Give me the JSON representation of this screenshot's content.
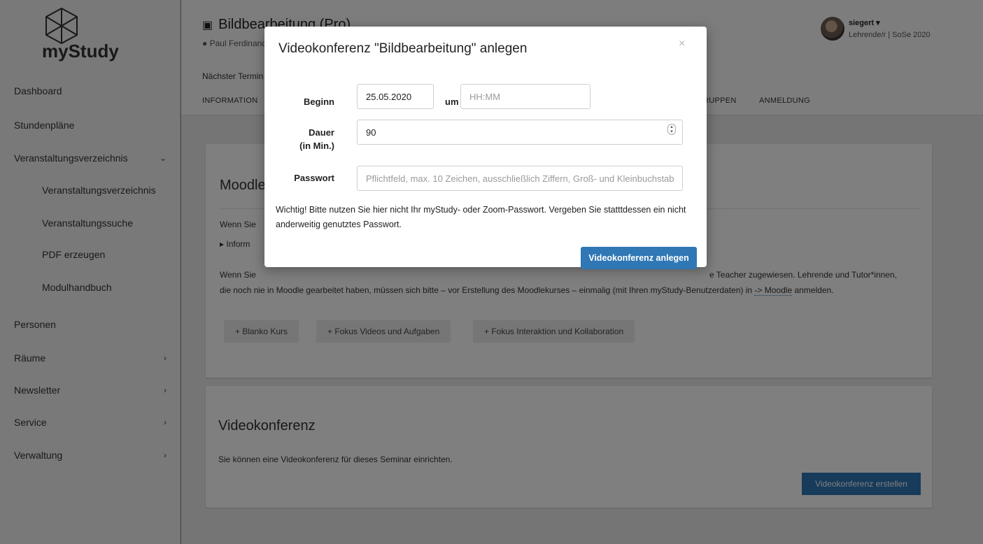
{
  "sidebar": {
    "logo_text": "myStudy",
    "items": [
      {
        "label": "Dashboard"
      },
      {
        "label": "Stundenpläne"
      },
      {
        "label": "Veranstaltungsverzeichnis",
        "chevron": "⌄"
      },
      {
        "label": "Veranstaltungsverzeichnis"
      },
      {
        "label": "Veranstaltungssuche"
      },
      {
        "label": "PDF erzeugen"
      },
      {
        "label": "Modulhandbuch"
      },
      {
        "label": "Personen"
      },
      {
        "label": "Räume",
        "chevron": "›"
      },
      {
        "label": "Newsletter",
        "chevron": "›"
      },
      {
        "label": "Service",
        "chevron": "›"
      },
      {
        "label": "Verwaltung",
        "chevron": "›"
      }
    ]
  },
  "header": {
    "course_title": "Bildbearbeitung (Pro)",
    "lecturer": "Paul Ferdinand",
    "next_date": "Nächster Termin",
    "tabs": [
      "INFORMATION",
      "RUPPEN",
      "ANMELDUNG"
    ],
    "user_name": "siegert ▾",
    "user_role": "Lehrende/r | SoSe 2020"
  },
  "moodle": {
    "title": "Moodle",
    "wenn1": "Wenn Sie",
    "info": "▸ Inform",
    "wenn2": "Wenn Sie",
    "teacher_text": "e Teacher zugewiesen. Lehrende und Tutor*innen,",
    "line2_pre": "die noch nie in Moodle gearbeitet haben, müssen sich bitte – vor Erstellung des Moodlekurses – einmalig (mit Ihren myStudy-Benutzerdaten) in ",
    "line2_link": "-> Moodle",
    "line2_post": " anmelden.",
    "buttons": [
      "+ Blanko Kurs",
      "+ Fokus Videos und Aufgaben",
      "+ Fokus Interaktion und Kollaboration"
    ]
  },
  "video": {
    "title": "Videokonferenz",
    "desc": "Sie können eine Videokonferenz für dieses Seminar einrichten.",
    "create_label": "Videokonferenz erstellen"
  },
  "modal": {
    "title": "Videokonferenz \"Bildbearbeitung\" anlegen",
    "close": "×",
    "beginn_label": "Beginn",
    "date_value": "25.05.2020",
    "um_label": "um",
    "time_placeholder": "HH:MM",
    "dauer_label": "Dauer",
    "dauer_unit": "(in Min.)",
    "dauer_value": "90",
    "passwort_label": "Passwort",
    "passwort_placeholder": "Pflichtfeld, max. 10 Zeichen, ausschließlich Ziffern, Groß- und Kleinbuchstaben",
    "warning": "Wichtig! Bitte nutzen Sie hier nicht Ihr myStudy- oder Zoom-Passwort. Vergeben Sie statttdessen ein nicht anderweitig genutztes Passwort.",
    "submit_label": "Videokonferenz anlegen"
  },
  "colors": {
    "primary": "#2f77b5",
    "overlay": "rgba(0,0,0,0.5)"
  }
}
